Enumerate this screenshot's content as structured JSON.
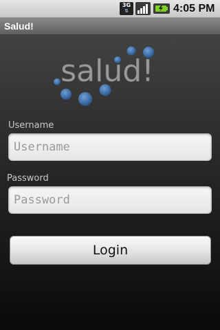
{
  "status_bar": {
    "network_badge": "3G",
    "signal_icon": "signal-strength-icon",
    "battery_icon": "battery-charging-icon",
    "time": "4:05 PM"
  },
  "app": {
    "title": "Salud!"
  },
  "logo": {
    "text": "salud!",
    "dot_color": "#3d6ea8"
  },
  "form": {
    "username": {
      "label": "Username",
      "value": "",
      "placeholder": "Username"
    },
    "password": {
      "label": "Password",
      "value": "",
      "placeholder": "Password"
    },
    "login_label": "Login"
  }
}
